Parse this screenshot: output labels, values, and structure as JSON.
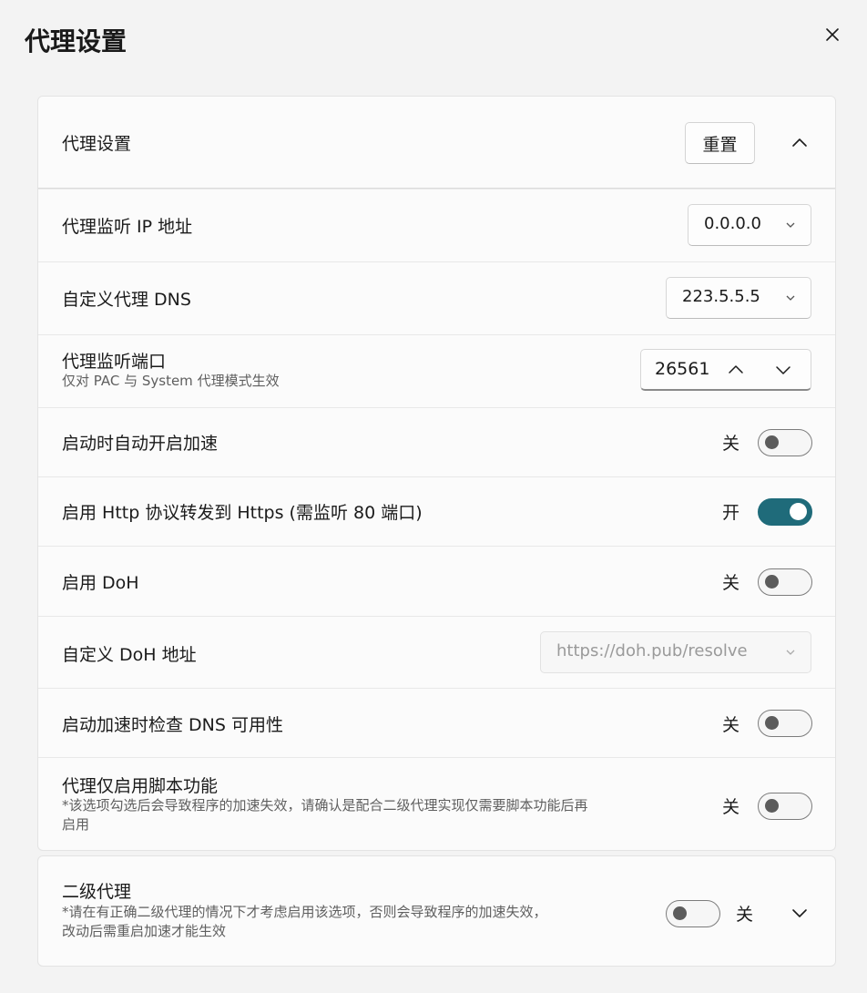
{
  "window": {
    "title": "代理设置"
  },
  "proxy_panel": {
    "header_label": "代理设置",
    "reset_label": "重置",
    "rows": {
      "listen_ip": {
        "label": "代理监听 IP 地址",
        "value": "0.0.0.0"
      },
      "custom_dns": {
        "label": "自定义代理 DNS",
        "value": "223.5.5.5"
      },
      "listen_port": {
        "label": "代理监听端口",
        "sub": "仅对 PAC 与 System 代理模式生效",
        "value": "26561"
      },
      "auto_start": {
        "label": "启动时自动开启加速",
        "state": "关"
      },
      "http_to_https": {
        "label": "启用 Http 协议转发到 Https (需监听 80 端口)",
        "state": "开"
      },
      "doh": {
        "label": "启用 DoH",
        "state": "关"
      },
      "custom_doh": {
        "label": "自定义 DoH 地址",
        "placeholder": "https://doh.pub/resolve"
      },
      "check_dns": {
        "label": "启动加速时检查 DNS 可用性",
        "state": "关"
      },
      "script_only": {
        "label": "代理仅启用脚本功能",
        "sub1": "*该选项勾选后会导致程序的加速失效，请确认是配合二级代理实现仅需要脚本功能后再",
        "sub2": "启用",
        "state": "关"
      }
    }
  },
  "secondary_panel": {
    "label": "二级代理",
    "sub1": "*请在有正确二级代理的情况下才考虑启用该选项，否则会导致程序的加速失效，",
    "sub2": "改动后需重启加速才能生效",
    "state": "关"
  },
  "colors": {
    "accent": "#1f6b7a"
  }
}
